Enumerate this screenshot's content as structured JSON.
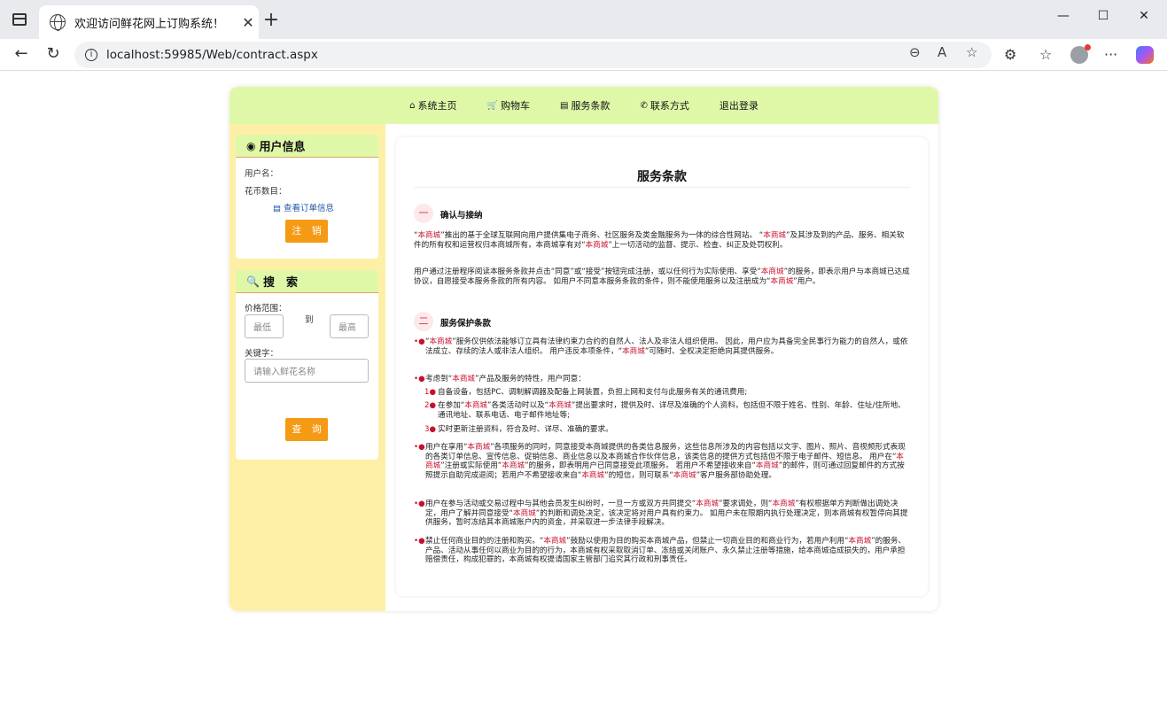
{
  "browser": {
    "tab_title": "欢迎访问鲜花网上订购系统！",
    "url": "localhost:59985/Web/contract.aspx"
  },
  "nav": {
    "home": "系统主页",
    "cart": "购物车",
    "terms": "服务条款",
    "contact": "联系方式",
    "logout": "退出登录"
  },
  "user_panel": {
    "title": "用户信息",
    "username_label": "用户名：",
    "coins_label": "花币数目：",
    "orders_link": "查看订单信息",
    "logout_button": "注 销"
  },
  "search_panel": {
    "title": "搜　索",
    "price_label": "价格范围：",
    "min_placeholder": "最低",
    "to_label": "到",
    "max_placeholder": "最高",
    "keyword_label": "关键字：",
    "keyword_placeholder": "请输入鲜花名称",
    "search_button": "查 询"
  },
  "doc": {
    "title": "服务条款",
    "sections": [
      {
        "num": "一",
        "title": "确认与接纳"
      },
      {
        "num": "二",
        "title": "服务保护条款"
      }
    ],
    "brand": "本商城",
    "p1": [
      "“",
      "本商城",
      "”推出的基于全球互联网向用户提供集电子商务、社区服务及类金融服务为一体的综合性网站。 “",
      "本商城",
      "”及其涉及到的产品、服务、相关软件的所有权和运营权归本商城所有，本商城享有对“",
      "本商城",
      "”上一切活动的监督、提示、检查、纠正及处罚权利。"
    ],
    "p2": [
      "用户通过注册程序阅读本服务条款并点击“同意”或“接受”按钮完成注册，或以任何行为实际使用、享受“",
      "本商城",
      "”的服务，即表示用户与本商城已达成协议，自愿接受本服务条款的所有内容。 如用户不同意本服务条款的条件，则不能使用服务以及注册成为“",
      "本商城",
      "”用户。"
    ],
    "b1": [
      "“",
      "本商城",
      "”服务仅供依法能够订立具有法律约束力合约的自然人、法人及非法人组织使用。 因此，用户应为具备完全民事行为能力的自然人，或依法成立、存续的法人或非法人组织。 用户违反本项条件，“",
      "本商城",
      "”可随时、全权决定拒绝向其提供服务。"
    ],
    "b2": [
      "考虑到“",
      "本商城",
      "”产品及服务的特性，用户同意："
    ],
    "s1": "自备设备，包括PC、调制解调器及配备上网装置，负担上网和支付与此服务有关的通讯费用;",
    "s2": [
      "在参加“",
      "本商城",
      "”各类活动时以及“",
      "本商城",
      "”提出要求时，提供及时、详尽及准确的个人资料，包括但不限于姓名、性别、年龄、住址/住所地、通讯地址、联系电话、电子邮件地址等;"
    ],
    "s3": "实时更新注册资料，符合及时、详尽、准确的要求。",
    "b3": [
      "用户在享用“",
      "本商城",
      "”各项服务的同时，同意接受本商城提供的各类信息服务，这些信息所涉及的内容包括以文字、图片、照片、音视频形式表现的各类订单信息、宣传信息、促销信息、商业信息以及本商城合作伙伴信息，该类信息的提供方式包括但不限于电子邮件、短信息。 用户在“",
      "本商城",
      "”注册或实际使用“",
      "本商城",
      "”的服务，即表明用户已同意接受此项服务。 若用户不希望接收来自“",
      "本商城",
      "”的邮件，则可通过回复邮件的方式按照提示自助完成退阅；若用户不希望接收来自“",
      "本商城",
      "”的短信，则可联系“",
      "本商城",
      "”客户服务部协助处理。"
    ],
    "b4": [
      "用户在参与活动或交易过程中与其他会员发生纠纷时，一旦一方或双方共同提交“",
      "本商城",
      "”要求调处，则“",
      "本商城",
      "”有权根据单方判断做出调处决定，用户了解并同意接受“",
      "本商城",
      "”的判断和调处决定，该决定将对用户具有约束力。 如用户未在限期内执行处理决定，则本商城有权暂停向其提供服务，暂时冻结其本商城账户内的资金，并采取进一步法律手段解决。"
    ],
    "b5": [
      "禁止任何商业目的的注册和购买。“",
      "本商城",
      "”鼓励以使用为目的购买本商城产品，但禁止一切商业目的和商业行为，若用户利用“",
      "本商城",
      "”的服务、产品、活动从事任何以商业为目的的行为，本商城有权采取取消订单、冻结或关闭账户、永久禁止注册等措施，给本商城造成损失的，用户承担赔偿责任，构成犯罪的，本商城有权提请国家主管部门追究其行政和刑事责任。"
    ],
    "sub_nums": [
      "1",
      "2",
      "3"
    ]
  }
}
